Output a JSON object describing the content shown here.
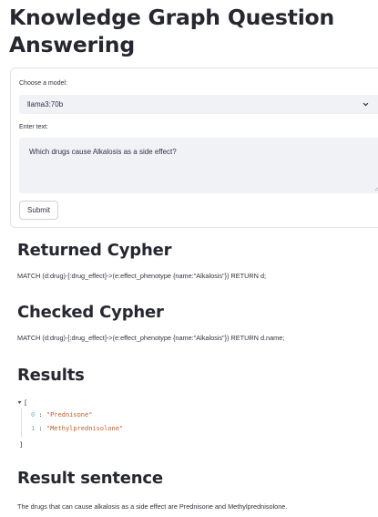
{
  "page_title": "Knowledge Graph Question Answering",
  "form": {
    "model_label": "Choose a model:",
    "model_value": "llama3:70b",
    "text_label": "Enter text:",
    "text_value": "Which drugs cause Alkalosis as a side effect?",
    "submit_label": "Submit"
  },
  "returned_cypher": {
    "heading": "Returned Cypher",
    "query": "MATCH (d:drug)-[:drug_effect]->(e:effect_phenotype {name:\"Alkalosis\"}) RETURN d;"
  },
  "checked_cypher": {
    "heading": "Checked Cypher",
    "query": "MATCH (d:drug)-[:drug_effect]->(e:effect_phenotype {name:\"Alkalosis\"}) RETURN d.name;"
  },
  "results": {
    "heading": "Results",
    "open_bracket": "[",
    "close_bracket": "]",
    "items": [
      {
        "index": "0",
        "value": "\"Prednisone\""
      },
      {
        "index": "1",
        "value": "\"Methylprednisolone\""
      }
    ]
  },
  "result_sentence": {
    "heading": "Result sentence",
    "text": "The drugs that can cause alkalosis as a side effect are Prednisone and Methylprednisolone."
  },
  "icons": {
    "select_chevron": "chevron-down-icon",
    "json_toggle": "caret-down-icon",
    "resize": "resize-grip-icon"
  }
}
